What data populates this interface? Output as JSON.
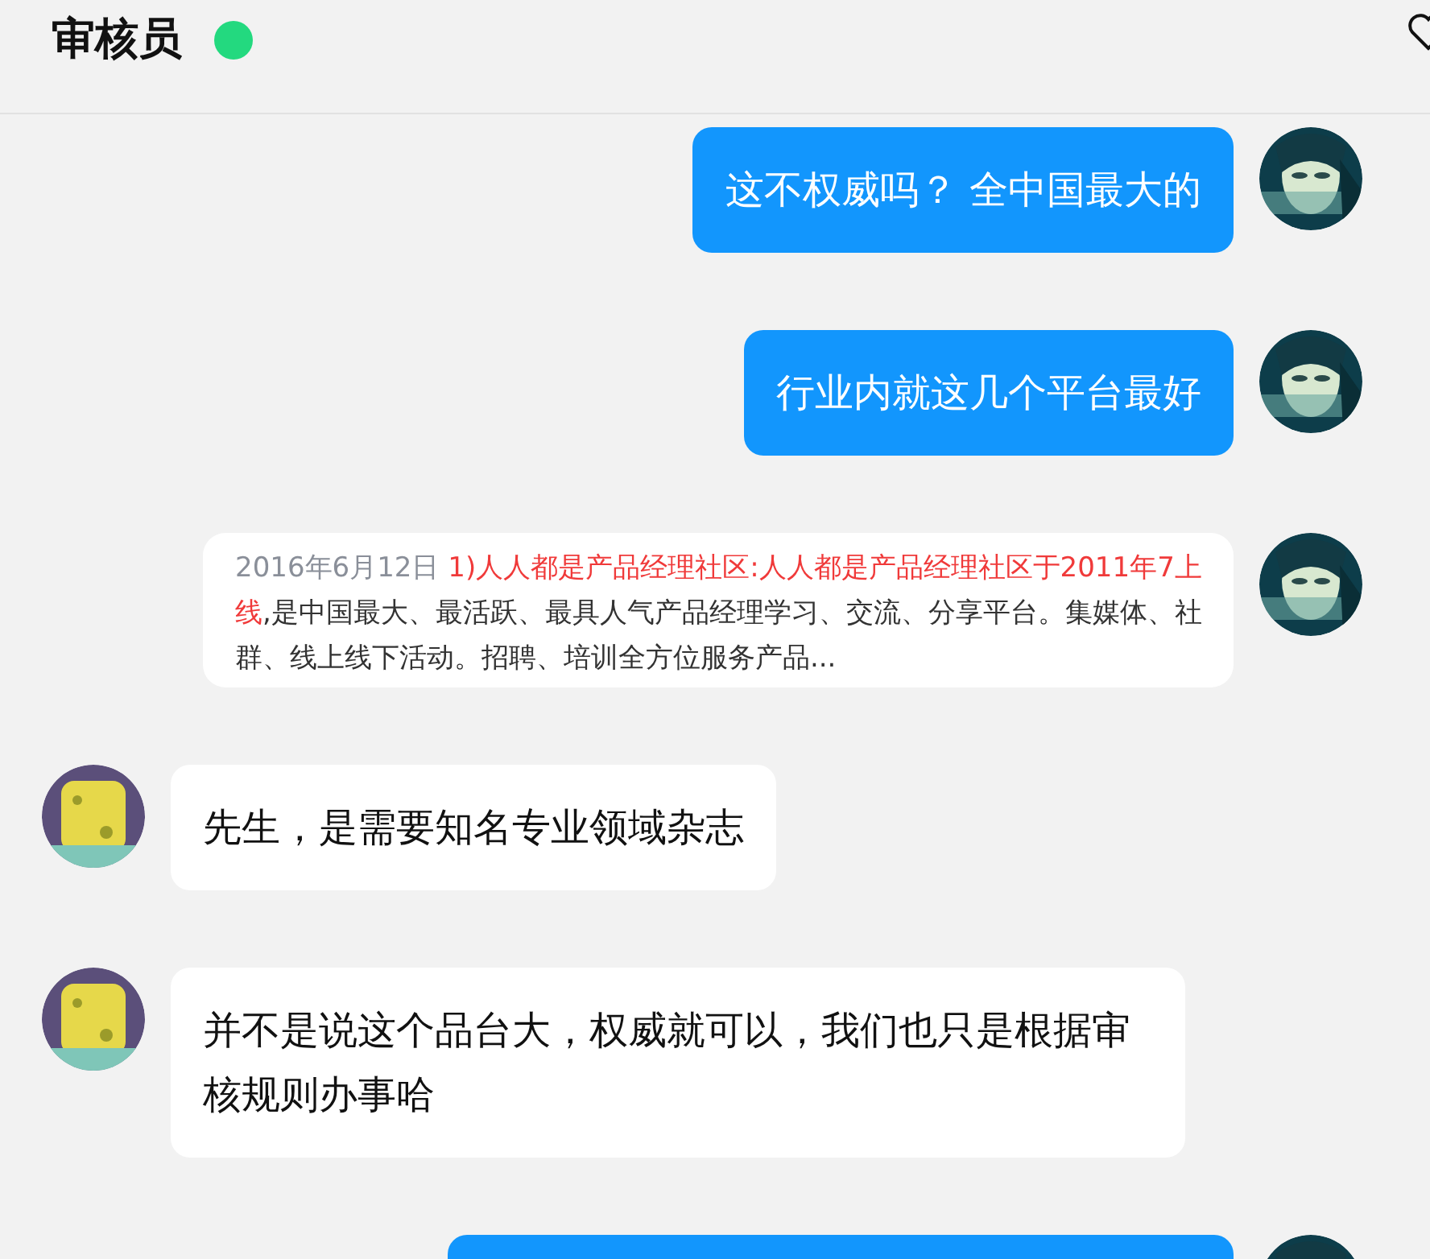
{
  "header": {
    "title": "审核员",
    "online": true
  },
  "messages": [
    {
      "outgoing": true,
      "kind": "text",
      "text": "这不权威吗？ 全中国最大的"
    },
    {
      "outgoing": true,
      "kind": "text",
      "text": "行业内就这几个平台最好"
    },
    {
      "outgoing": true,
      "kind": "link_card",
      "date": "2016年6月12日",
      "link": "1)人人都是产品经理社区:人人都是产品经理社区于2011年7上线",
      "body": ",是中国最大、最活跃、最具人气产品经理学习、交流、分享平台。集媒体、社群、线上线下活动。招聘、培训全方位服务产品..."
    },
    {
      "outgoing": false,
      "kind": "text",
      "text": "先生，是需要知名专业领域杂志"
    },
    {
      "outgoing": false,
      "kind": "text",
      "text": "并不是说这个品台大，权威就可以，我们也只是根据审核规则办事哈"
    },
    {
      "outgoing": true,
      "kind": "partial"
    }
  ]
}
